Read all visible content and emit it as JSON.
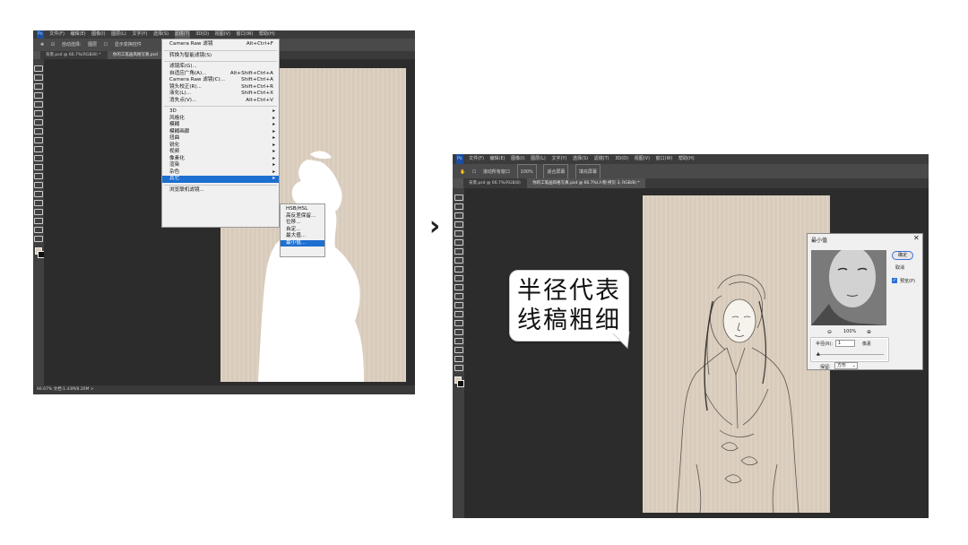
{
  "arrow": "›",
  "left": {
    "menubar": [
      "文件(F)",
      "编辑(E)",
      "图像(I)",
      "图层(L)",
      "文字(Y)",
      "选择(S)",
      "滤镜(T)",
      "3D(D)",
      "视图(V)",
      "窗口(W)",
      "帮助(H)"
    ],
    "options": [
      "自动选择:",
      "图层",
      "显示变换控件"
    ],
    "tabs": [
      "背景.psd @ 66.7%(RGB/8) *",
      "你的工笔画风格写真.psd"
    ],
    "status": "66.67%      文档:1.43M/8.20M      >",
    "filter_menu": {
      "top": [
        {
          "label": "Camera Raw 滤镜",
          "shortcut": "Alt+Ctrl+F"
        },
        {
          "label": "转换为智能滤镜(S)",
          "shortcut": ""
        }
      ],
      "middle": [
        {
          "label": "滤镜库(G)...",
          "shortcut": ""
        },
        {
          "label": "自适应广角(A)...",
          "shortcut": "Alt+Shift+Ctrl+A"
        },
        {
          "label": "Camera Raw 滤镜(C)...",
          "shortcut": "Shift+Ctrl+A"
        },
        {
          "label": "镜头校正(R)...",
          "shortcut": "Shift+Ctrl+R"
        },
        {
          "label": "液化(L)...",
          "shortcut": "Shift+Ctrl+X"
        },
        {
          "label": "消失点(V)...",
          "shortcut": "Alt+Ctrl+V"
        }
      ],
      "sub": [
        "3D",
        "风格化",
        "模糊",
        "模糊画廊",
        "扭曲",
        "锐化",
        "视频",
        "像素化",
        "渲染",
        "杂色",
        "其它"
      ],
      "bottom": "浏览联机滤镜..."
    },
    "other_submenu": [
      "HSB/HSL",
      "高反差保留...",
      "位移...",
      "自定...",
      "最大值...",
      "最小值..."
    ]
  },
  "right": {
    "menubar": [
      "文件(F)",
      "编辑(E)",
      "图像(I)",
      "图层(L)",
      "文字(Y)",
      "选择(S)",
      "滤镜(T)",
      "3D(D)",
      "视图(V)",
      "窗口(W)",
      "帮助(H)"
    ],
    "options": [
      "滚动所有窗口",
      "100%",
      "适合屏幕",
      "填充屏幕"
    ],
    "tabs": [
      "背景.psd @ 66.7%(RGB/8)",
      "你的工笔画风格写真.psd @ 66.7%(人物 拷贝 3, RGB/8) *"
    ],
    "dialog": {
      "title": "最小值",
      "ok": "确定",
      "cancel": "取消",
      "preview": "预览(P)",
      "zoom": "100%",
      "radius_label": "半径(R):",
      "radius_value": "1",
      "unit": "像素",
      "keep_label": "保留:",
      "keep_value": "方形"
    },
    "bubble": {
      "line1": "半径代表",
      "line2": "线稿粗细"
    }
  }
}
